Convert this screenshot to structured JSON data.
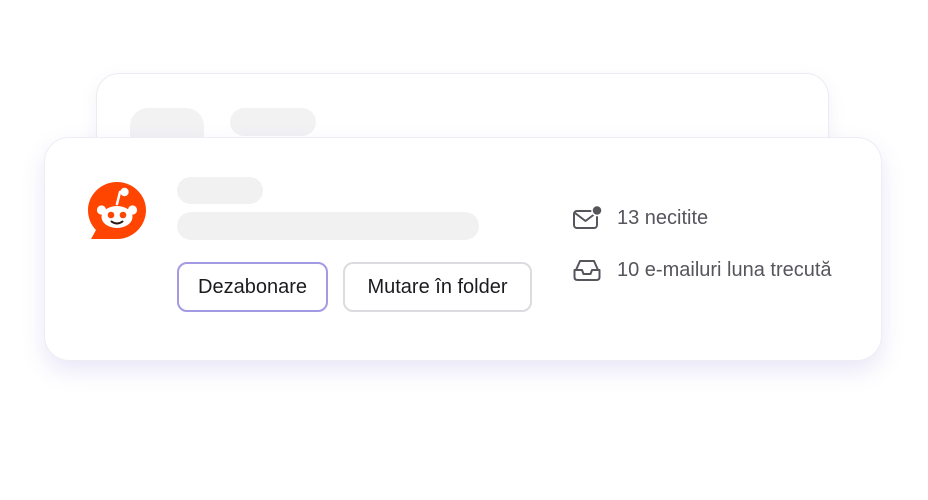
{
  "colors": {
    "brand": "#ff4500",
    "accent_border": "#a39ae6",
    "neutral_border": "#dcdce0",
    "placeholder": "#f1f1f2",
    "text_primary": "#1b1b1f",
    "text_secondary": "#55555c"
  },
  "sender": {
    "logo_icon": "reddit-logo-icon"
  },
  "actions": {
    "unsubscribe_label": "Dezabonare",
    "move_label": "Mutare în folder"
  },
  "stats": {
    "unread": {
      "icon": "mail-unread-icon",
      "label": "13 necitite"
    },
    "last_month": {
      "icon": "inbox-tray-icon",
      "label": "10 e-mailuri luna trecută"
    }
  }
}
